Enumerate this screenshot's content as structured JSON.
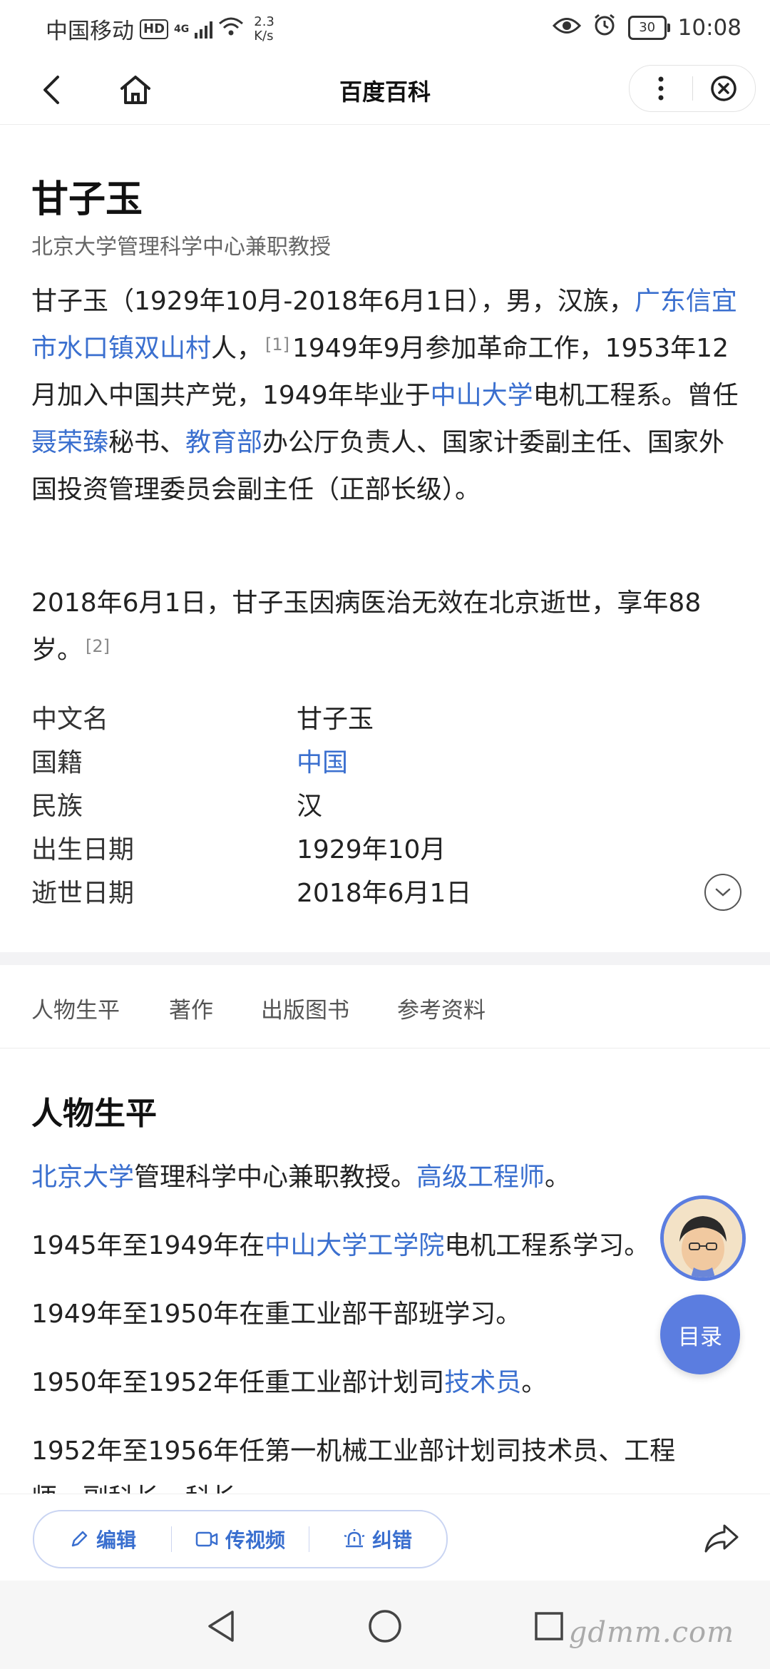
{
  "status_bar": {
    "carrier": "中国移动",
    "hd": "HD",
    "signal": "4G",
    "net_speed_value": "2.3",
    "net_speed_unit": "K/s",
    "battery": "30",
    "time": "10:08"
  },
  "nav": {
    "title": "百度百科"
  },
  "article": {
    "title": "甘子玉",
    "subtitle": "北京大学管理科学中心兼职教授",
    "para1": {
      "t1": "甘子玉（1929年10月-2018年6月1日），男，汉族，",
      "link1": "广东信宜市水口镇双山村",
      "t2": "人，",
      "ref1": "[1]",
      "t3": "1949年9月参加革命工作，1953年12月加入中国共产党，1949年毕业于",
      "link2": "中山大学",
      "t4": "电机工程系。曾任",
      "link3": "聂荣臻",
      "t5": "秘书、",
      "link4": "教育部",
      "t6": "办公厅负责人、国家计委副主任、国家外国投资管理委员会副主任（正部长级）。"
    },
    "para2": {
      "text": "2018年6月1日，甘子玉因病医治无效在北京逝世，享年88岁。",
      "ref": "[2]"
    },
    "info": [
      {
        "label": "中文名",
        "value": "甘子玉"
      },
      {
        "label": "国籍",
        "value": "中国"
      },
      {
        "label": "民族",
        "value": "汉"
      },
      {
        "label": "出生日期",
        "value": "1929年10月"
      },
      {
        "label": "逝世日期",
        "value": "2018年6月1日"
      }
    ]
  },
  "tabs": [
    "人物生平",
    "著作",
    "出版图书",
    "参考资料"
  ],
  "section": {
    "title": "人物生平",
    "l1_link1": "北京大学",
    "l1_t1": "管理科学中心兼职教授。",
    "l1_link2": "高级工程师",
    "l1_t2": "。",
    "l2_t1": "1945年至1949年在",
    "l2_link": "中山大学工学院",
    "l2_t2": "电机工程系学习。",
    "l3": "1949年至1950年在重工业部干部班学习。",
    "l4_t1": "1950年至1952年任重工业部计划司",
    "l4_link": "技术员",
    "l4_t2": "。",
    "l5": "1952年至1956年任第一机械工业部计划司技术员、工程",
    "l6": "师、副科长、科长。"
  },
  "fab": {
    "toc": "目录"
  },
  "actions": {
    "edit": "编辑",
    "video": "传视频",
    "correct": "纠错"
  },
  "watermark": "gdmm.com",
  "colors": {
    "link": "#3a6fcf",
    "fab": "#5b7de0"
  }
}
